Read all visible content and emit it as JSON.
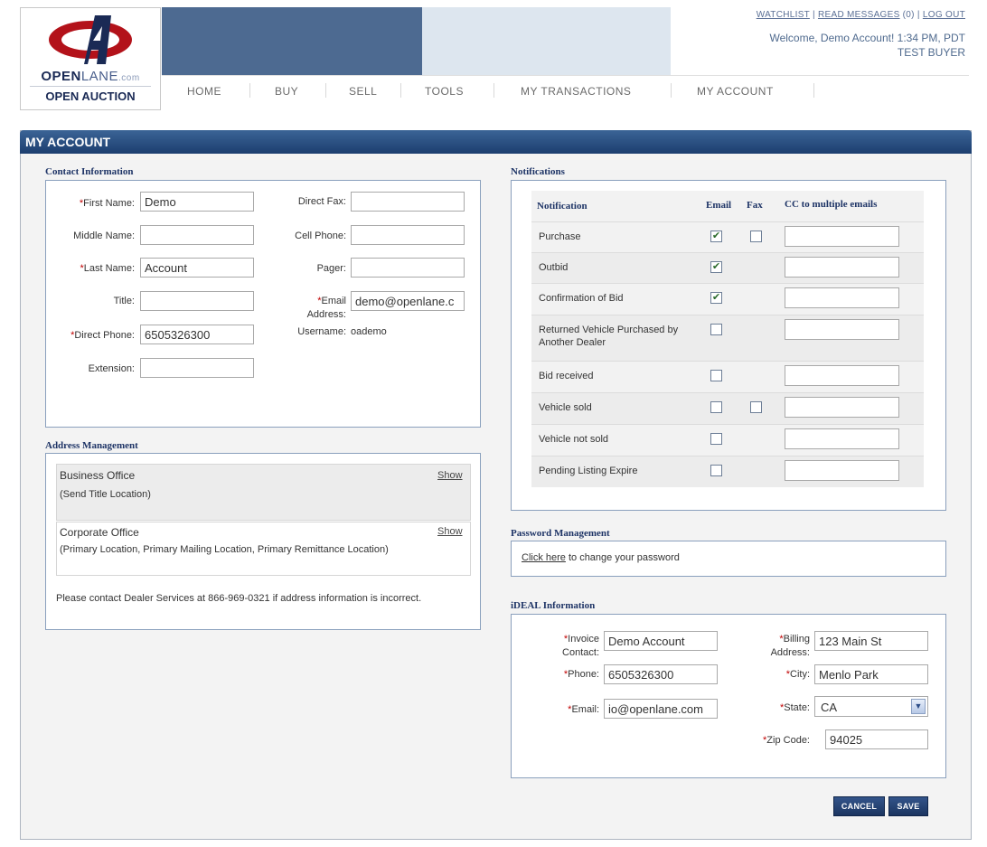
{
  "logo": {
    "brand_bold": "OPEN",
    "brand_thin": "LANE",
    "brand_domain": ".com",
    "sub": "OPEN AUCTION"
  },
  "utility": {
    "watchlist": "WATCHLIST",
    "sep1": "|",
    "read_messages": "READ MESSAGES",
    "count": "(0)",
    "sep2": "|",
    "logout": "LOG OUT"
  },
  "welcome": {
    "line1": "Welcome, Demo Account! 1:34 PM, PDT",
    "line2": "TEST BUYER"
  },
  "nav": [
    "HOME",
    "BUY",
    "SELL",
    "TOOLS",
    "MY TRANSACTIONS",
    "MY ACCOUNT"
  ],
  "page_title": "MY ACCOUNT",
  "contact": {
    "title": "Contact Information",
    "first_name": {
      "label": "First Name:",
      "value": "Demo"
    },
    "middle_name": {
      "label": "Middle Name:",
      "value": ""
    },
    "last_name": {
      "label": "Last Name:",
      "value": "Account"
    },
    "title_field": {
      "label": "Title:",
      "value": ""
    },
    "direct_phone": {
      "label": "Direct Phone:",
      "value": "6505326300"
    },
    "extension": {
      "label": "Extension:",
      "value": ""
    },
    "direct_fax": {
      "label": "Direct Fax:",
      "value": ""
    },
    "cell_phone": {
      "label": "Cell Phone:",
      "value": ""
    },
    "pager": {
      "label": "Pager:",
      "value": ""
    },
    "email": {
      "label_1": "Email",
      "label_2": "Address:",
      "value": "demo@openlane.c"
    },
    "username": {
      "label": "Username:",
      "value": "oademo"
    }
  },
  "address": {
    "title": "Address Management",
    "items": [
      {
        "name": "Business Office",
        "detail": "(Send Title Location)",
        "action": "Show"
      },
      {
        "name": "Corporate Office",
        "detail": "(Primary Location, Primary Mailing Location, Primary Remittance Location)",
        "action": "Show"
      }
    ],
    "note": "Please contact Dealer Services at 866-969-0321 if address information is incorrect."
  },
  "notifications": {
    "title": "Notifications",
    "headers": {
      "notification": "Notification",
      "email": "Email",
      "fax": "Fax",
      "cc": "CC to multiple emails"
    },
    "rows": [
      {
        "label": "Purchase",
        "email": true,
        "fax": false,
        "has_fax": true
      },
      {
        "label": "Outbid",
        "email": true,
        "fax": false,
        "has_fax": false
      },
      {
        "label": "Confirmation of Bid",
        "email": true,
        "fax": false,
        "has_fax": false
      },
      {
        "label": "Returned Vehicle Purchased by Another Dealer",
        "email": false,
        "fax": false,
        "has_fax": false
      },
      {
        "label": "Bid received",
        "email": false,
        "fax": false,
        "has_fax": false
      },
      {
        "label": "Vehicle sold",
        "email": false,
        "fax": false,
        "has_fax": true
      },
      {
        "label": "Vehicle not sold",
        "email": false,
        "fax": false,
        "has_fax": false
      },
      {
        "label": "Pending Listing Expire",
        "email": false,
        "fax": false,
        "has_fax": false
      }
    ]
  },
  "password": {
    "title": "Password Management",
    "link": "Click here",
    "text": " to change your password"
  },
  "ideal": {
    "title": "iDEAL Information",
    "invoice_contact": {
      "label_1": "Invoice",
      "label_2": "Contact:",
      "value": "Demo Account"
    },
    "phone": {
      "label": "Phone:",
      "value": "6505326300"
    },
    "email": {
      "label": "Email:",
      "value": "io@openlane.com"
    },
    "billing_address": {
      "label_1": "Billing",
      "label_2": "Address:",
      "value": "123 Main St"
    },
    "city": {
      "label": "City:",
      "value": "Menlo Park"
    },
    "state": {
      "label": "State:",
      "value": "CA"
    },
    "zip": {
      "label": "Zip Code:",
      "value": "94025"
    }
  },
  "buttons": {
    "cancel": "CANCEL",
    "save": "SAVE"
  },
  "colors": {
    "nav_dark": "#1c3e6f",
    "banner": "#4d6a91",
    "required": "#c00000"
  }
}
